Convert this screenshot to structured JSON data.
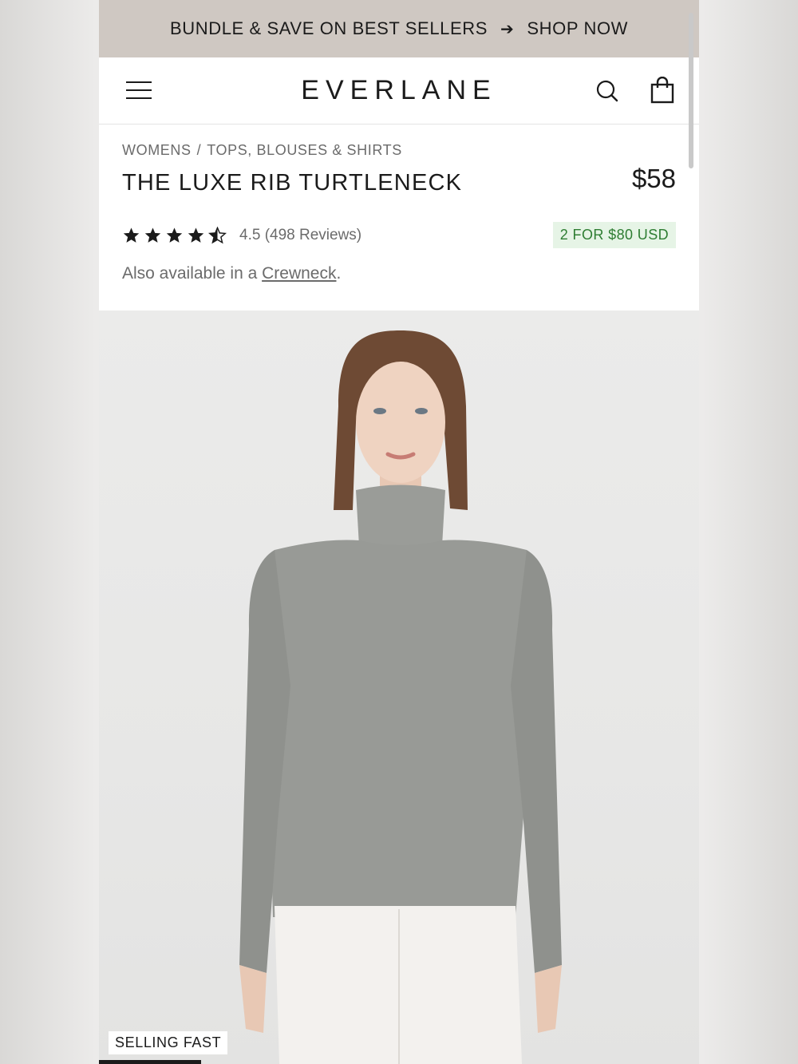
{
  "promo_bar": {
    "text": "BUNDLE & SAVE ON BEST SELLERS",
    "arrow": "➔",
    "cta": "SHOP NOW"
  },
  "header": {
    "logo": "EVERLANE",
    "icons": [
      "menu-icon",
      "search-icon",
      "shopping-bag-icon"
    ]
  },
  "breadcrumb": {
    "items": [
      "WOMENS",
      "TOPS, BLOUSES & SHIRTS"
    ],
    "separator": "/"
  },
  "product": {
    "title": "THE LUXE RIB TURTLENECK",
    "price": "$58",
    "rating": 4.5,
    "rating_text": "4.5 (498 Reviews)",
    "offer_badge": "2 FOR $80 USD",
    "alt_prefix": "Also available in a ",
    "alt_link": "Crewneck",
    "alt_suffix": "."
  },
  "image": {
    "badge": "SELLING FAST",
    "carousel_progress": 0.17
  },
  "colors": {
    "promo_bg": "#cfc8c2",
    "offer_bg": "#e6f4e6",
    "offer_text": "#2e7d32",
    "text": "#1b1b1b"
  }
}
